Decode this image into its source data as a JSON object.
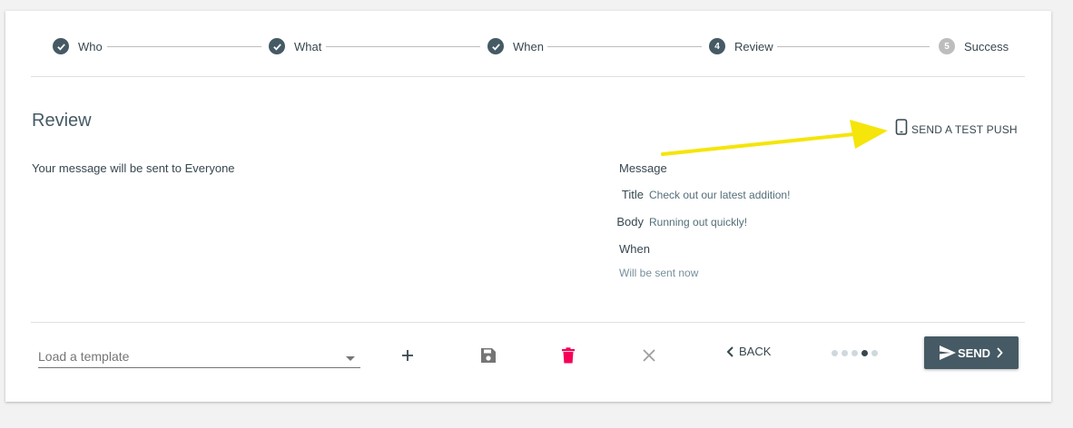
{
  "stepper": {
    "steps": [
      {
        "label": "Who",
        "state": "done"
      },
      {
        "label": "What",
        "state": "done"
      },
      {
        "label": "When",
        "state": "done"
      },
      {
        "label": "Review",
        "state": "active",
        "number": "4"
      },
      {
        "label": "Success",
        "state": "todo",
        "number": "5"
      }
    ]
  },
  "review": {
    "title": "Review",
    "summary": "Your message will be sent to Everyone",
    "test_push_label": "SEND A TEST PUSH",
    "message_heading": "Message",
    "title_key": "Title",
    "title_value": "Check out our latest addition!",
    "body_key": "Body",
    "body_value": "Running out quickly!",
    "when_heading": "When",
    "when_value": "Will be sent now"
  },
  "footer": {
    "template_placeholder": "Load a template",
    "back_label": "BACK",
    "send_label": "SEND",
    "page_dots_total": 5,
    "page_dots_active": 4
  },
  "colors": {
    "primary": "#455a64",
    "delete": "#f50057",
    "annotation_arrow": "#f5e50a"
  },
  "icons": {
    "done": "check-circle-icon",
    "test_push": "phone-icon",
    "add": "plus-icon",
    "save": "floppy-disk-icon",
    "delete": "trash-icon",
    "clear": "close-icon",
    "back": "chevron-left-icon",
    "send": "paper-plane-icon",
    "send_next": "chevron-right-icon",
    "dropdown": "caret-down-icon"
  }
}
